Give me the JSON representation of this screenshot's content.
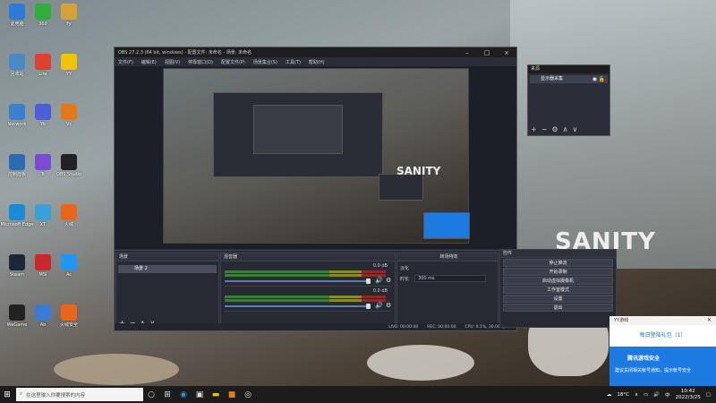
{
  "desktop": {
    "icons": [
      {
        "label": "此电脑",
        "icon": "computer-icon",
        "color": "#2e7bd6"
      },
      {
        "label": "回收站",
        "icon": "recycle-bin-icon",
        "color": "#4a89c8"
      },
      {
        "label": "Network",
        "icon": "network-icon",
        "color": "#3b7fd0"
      },
      {
        "label": "控制面板",
        "icon": "control-panel-icon",
        "color": "#2d6ab0"
      },
      {
        "label": "Microsoft Edge",
        "icon": "edge-icon",
        "color": "#1b8ad3"
      },
      {
        "label": "Steam",
        "icon": "steam-icon",
        "color": "#1b2838"
      },
      {
        "label": "WeGame",
        "icon": "wegame-icon",
        "color": "#222"
      },
      {
        "label": "火绒安全",
        "icon": "huorong-icon",
        "color": "#e8661b"
      },
      {
        "label": "360",
        "icon": "app-icon",
        "color": "#2fae3c"
      },
      {
        "label": "Lite",
        "icon": "lite-icon",
        "color": "#d9432f"
      },
      {
        "label": "Yb",
        "icon": "app-icon",
        "color": "#4c5fd5"
      },
      {
        "label": "Tr",
        "icon": "app-icon",
        "color": "#7a4cd5"
      },
      {
        "label": "XT",
        "icon": "app-icon",
        "color": "#3aa0d8"
      },
      {
        "label": "MSI",
        "icon": "app-icon",
        "color": "#c72a2a"
      },
      {
        "label": "Ab",
        "icon": "app-icon",
        "color": "#3a7bd5"
      },
      {
        "label": "Fy",
        "icon": "app-icon",
        "color": "#d5a23a"
      },
      {
        "label": "YY",
        "icon": "app-icon",
        "color": "#f0c400"
      },
      {
        "label": "Vc",
        "icon": "app-icon",
        "color": "#e07a1b"
      },
      {
        "label": "OBS Studio",
        "icon": "obs-icon",
        "color": "#222"
      },
      {
        "label": "火绒",
        "icon": "app-icon",
        "color": "#e8661b"
      },
      {
        "label": "Ac",
        "icon": "app-icon",
        "color": "#2196f3"
      }
    ]
  },
  "obs": {
    "title": "OBS 27.2.3 (64 bit, windows) - 配置文件: 未命名 - 场景: 未命名",
    "menu": [
      "文件(F)",
      "编辑(E)",
      "视图(V)",
      "停靠窗口(D)",
      "配置文件(P)",
      "场景集合(S)",
      "工具(T)",
      "帮助(H)"
    ],
    "preview_text": "SANITY",
    "scenes_header": "场景",
    "scene_item": "场景 2",
    "mixer_header": "混音器",
    "mixer_db1": "0.0 dB",
    "mixer_db2": "0.0 dB",
    "trans_header": "转场特效",
    "trans_label1": "淡化",
    "trans_label2": "时长",
    "trans_value": "300 ms",
    "controls_header": "控件",
    "controls": [
      "停止推流",
      "开始录制",
      "启动虚拟摄像机",
      "工作室模式",
      "设置",
      "退出"
    ],
    "status": {
      "live": "LIVE: 00:00:00",
      "rec": "REC: 00:00:00",
      "cpu": "CPU: 0.1%, 30.00 fps"
    }
  },
  "sources_panel": {
    "header": "来源",
    "item": "显示器采集"
  },
  "wallpaper_text": "SANITY",
  "notification": {
    "app": "YY游戏",
    "title": "每日登陆礼包（1）",
    "banner_title": "腾讯游戏安全",
    "banner_body": "建议关闭相关帐号通知，提示帐号安全"
  },
  "taskbar": {
    "search_placeholder": "在这里输入你要搜索的内容",
    "weather": "18°C",
    "time": "10:42",
    "date": "2022/3/25"
  }
}
